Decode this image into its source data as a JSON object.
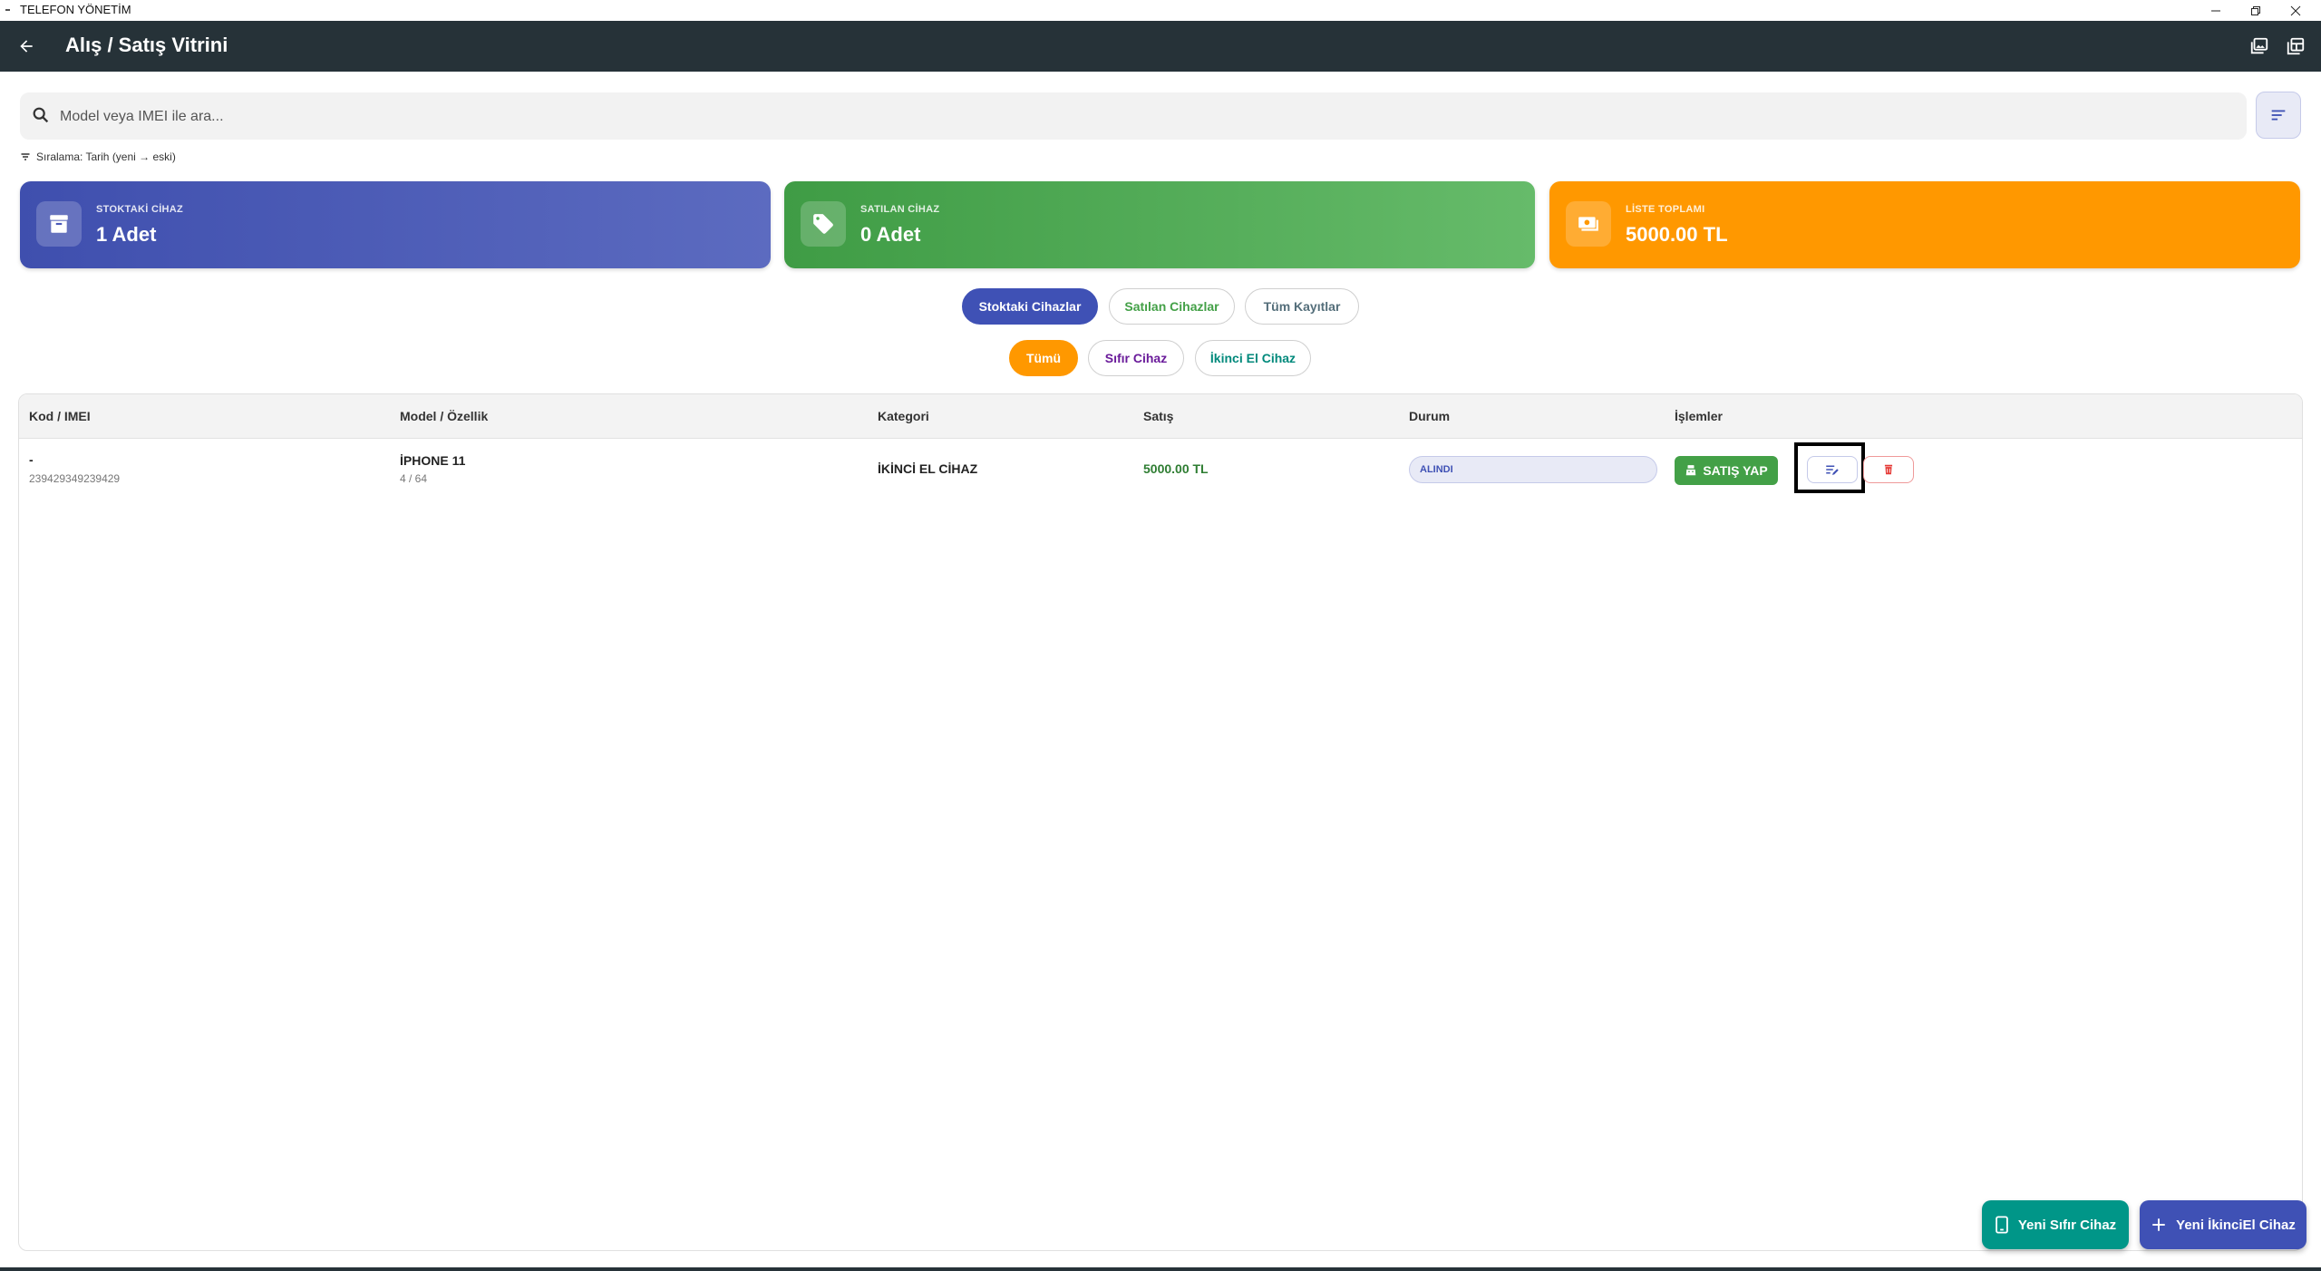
{
  "os": {
    "title": "TELEFON YÖNETİM",
    "minimize": "—",
    "restore": "❐",
    "close": "✕"
  },
  "appbar": {
    "title": "Alış / Satış Vitrini"
  },
  "search": {
    "placeholder": "Model veya IMEI ile ara..."
  },
  "sort": {
    "label": "Sıralama: Tarih (yeni → eski)"
  },
  "stats": [
    {
      "label": "STOKTAKİ CİHAZ",
      "value": "1 Adet"
    },
    {
      "label": "SATILAN CİHAZ",
      "value": "0 Adet"
    },
    {
      "label": "LİSTE TOPLAMI",
      "value": "5000.00 TL"
    }
  ],
  "filters": {
    "status_tabs": [
      "Stoktaki Cihazlar",
      "Satılan Cihazlar",
      "Tüm Kayıtlar"
    ],
    "category_tabs": [
      "Tümü",
      "Sıfır Cihaz",
      "İkinci El Cihaz"
    ]
  },
  "table": {
    "columns": [
      "Kod / IMEI",
      "Model / Özellik",
      "Kategori",
      "Satış",
      "Durum",
      "İşlemler"
    ],
    "rows": [
      {
        "code": "-",
        "imei": "239429349239429",
        "model": "İPHONE 11",
        "spec": "4 / 64",
        "category": "İKİNCİ EL CİHAZ",
        "price": "5000.00 TL",
        "status": "ALINDI",
        "sell_label": "SATIŞ YAP"
      }
    ]
  },
  "fabs": {
    "new_zero": "Yeni Sıfır Cihaz",
    "new_second": "Yeni İkinciEl Cihaz"
  },
  "colors": {
    "appbar": "#263238",
    "indigo": "#3f51b5",
    "green": "#43a047",
    "orange": "#ff9800",
    "teal": "#009688",
    "red": "#e53935"
  }
}
